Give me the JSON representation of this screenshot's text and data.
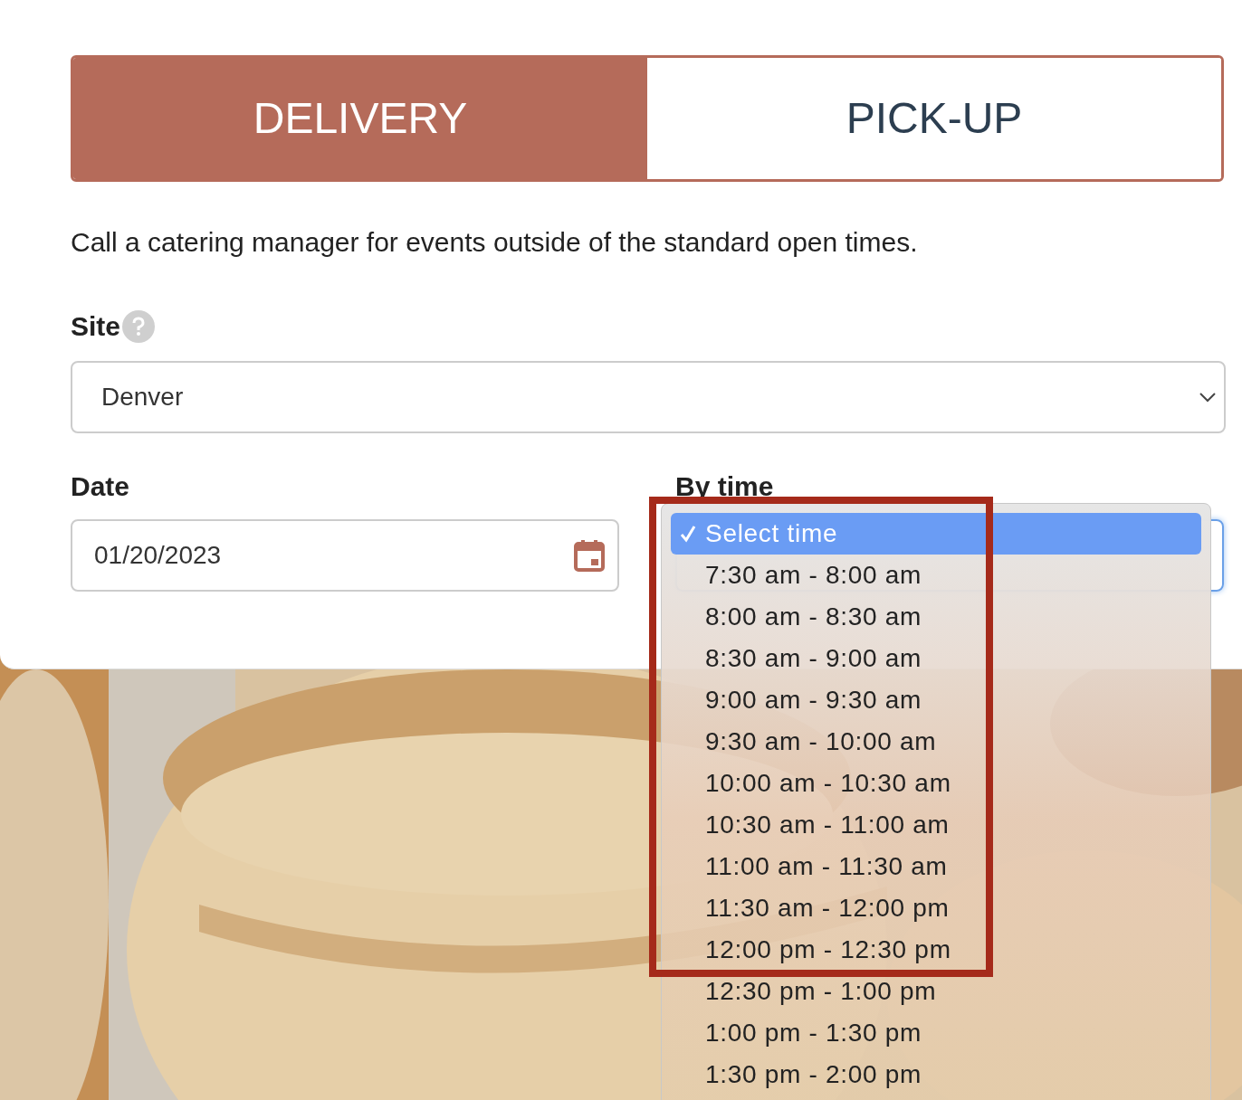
{
  "order_types": [
    {
      "label": "DELIVERY",
      "selected": true
    },
    {
      "label": "PICK-UP",
      "selected": false
    }
  ],
  "notice": "Call a catering manager for events outside of the standard open times.",
  "site": {
    "label": "Site",
    "value": "Denver"
  },
  "date": {
    "label": "Date",
    "value": "01/20/2023"
  },
  "by_time": {
    "label": "By time",
    "expanded": true,
    "options": [
      {
        "label": "Select time",
        "selected": true
      },
      {
        "label": "7:30 am - 8:00 am",
        "selected": false
      },
      {
        "label": "8:00 am - 8:30 am",
        "selected": false
      },
      {
        "label": "8:30 am - 9:00 am",
        "selected": false
      },
      {
        "label": "9:00 am - 9:30 am",
        "selected": false
      },
      {
        "label": "9:30 am - 10:00 am",
        "selected": false
      },
      {
        "label": "10:00 am - 10:30 am",
        "selected": false
      },
      {
        "label": "10:30 am - 11:00 am",
        "selected": false
      },
      {
        "label": "11:00 am - 11:30 am",
        "selected": false
      },
      {
        "label": "11:30 am - 12:00 pm",
        "selected": false
      },
      {
        "label": "12:00 pm - 12:30 pm",
        "selected": false
      },
      {
        "label": "12:30 pm - 1:00 pm",
        "selected": false
      },
      {
        "label": "1:00 pm - 1:30 pm",
        "selected": false
      },
      {
        "label": "1:30 pm - 2:00 pm",
        "selected": false
      }
    ]
  }
}
